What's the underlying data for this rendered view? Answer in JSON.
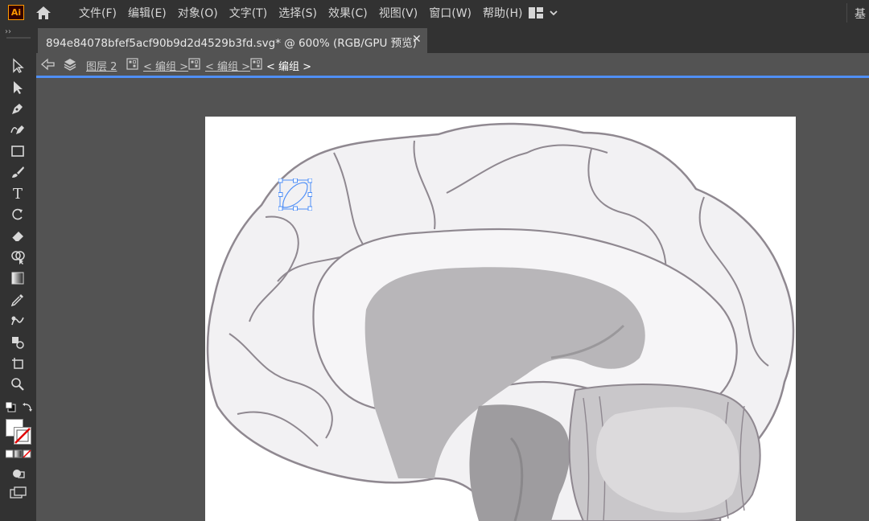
{
  "app": {
    "logo": "Ai"
  },
  "menu": [
    "文件(F)",
    "编辑(E)",
    "对象(O)",
    "文字(T)",
    "选择(S)",
    "效果(C)",
    "视图(V)",
    "窗口(W)",
    "帮助(H)"
  ],
  "workspace": {
    "label": "基"
  },
  "toolbar": {
    "collapse": "››"
  },
  "document": {
    "tab_title": "894e84078bfef5acf90b9d2d4529b3fd.svg* @ 600% (RGB/GPU 预览)",
    "close": "✕"
  },
  "breadcrumb": {
    "layer": "图层 2",
    "group1": "< 编组 >",
    "group2": "< 编组 >",
    "group3": "< 编组 >"
  },
  "colors": {
    "accent": "#4f8ff7",
    "chrome": "#323232",
    "canvas": "#535353"
  }
}
